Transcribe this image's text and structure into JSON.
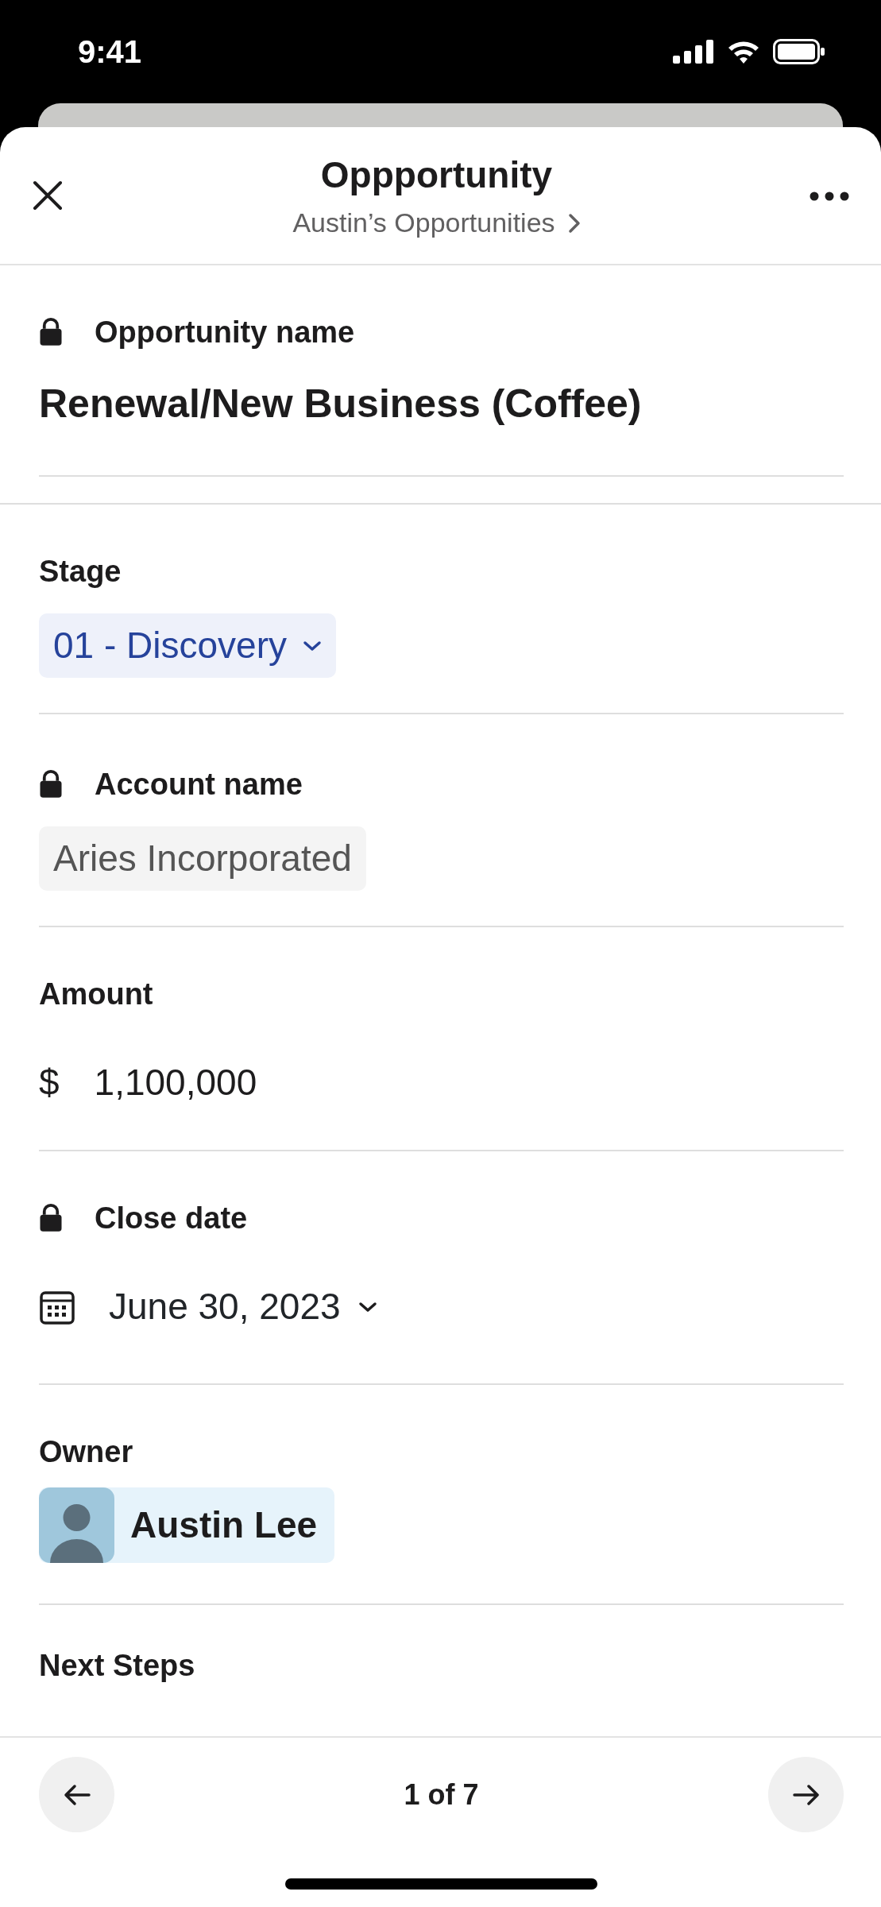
{
  "status_bar": {
    "time": "9:41"
  },
  "header": {
    "title": "Oppportunity",
    "subtitle": "Austin’s Opportunities"
  },
  "fields": [
    {
      "kind": "title",
      "label": "Opportunity name",
      "locked": true,
      "value": "Renewal/New Business (Coffee)"
    },
    {
      "kind": "picklist",
      "label": "Stage",
      "locked": false,
      "value": "01 - Discovery"
    },
    {
      "kind": "readonly",
      "label": "Account name",
      "locked": true,
      "value": "Aries Incorporated"
    },
    {
      "kind": "currency",
      "label": "Amount",
      "locked": false,
      "symbol": "$",
      "value": "1,100,000"
    },
    {
      "kind": "date",
      "label": "Close date",
      "locked": true,
      "value": "June 30, 2023"
    },
    {
      "kind": "user",
      "label": "Owner",
      "locked": false,
      "value": "Austin Lee"
    },
    {
      "kind": "cut",
      "label": "Next Steps",
      "locked": false
    }
  ],
  "pager": {
    "text": "1 of 7"
  }
}
